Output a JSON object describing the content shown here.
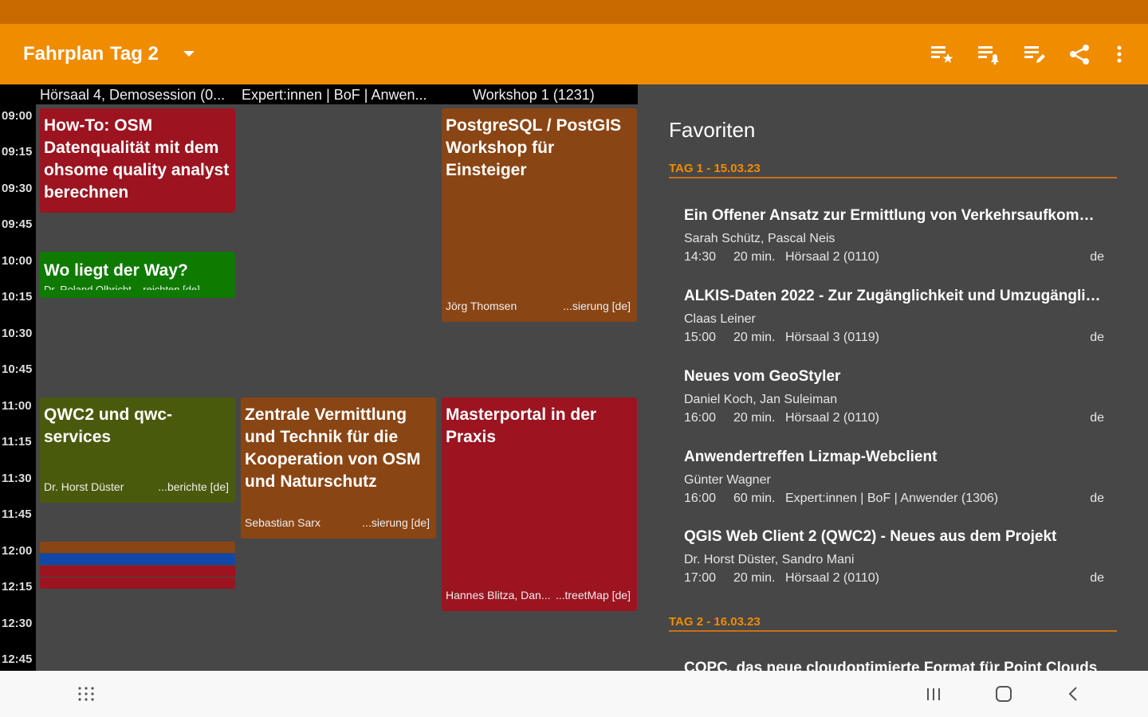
{
  "toolbar": {
    "app_title": "Fahrplan",
    "day_title": "Tag 2",
    "accent": "#f08c00",
    "icons": [
      "starred-list-icon",
      "alarm-list-icon",
      "changes-list-icon",
      "share-icon",
      "more-vert-icon"
    ]
  },
  "schedule": {
    "rooms": [
      "Hörsaal 4, Demosession (0...",
      "Expert:innen | BoF | Anwen...",
      "Workshop 1 (1231)"
    ],
    "times": [
      "09:00",
      "09:15",
      "09:30",
      "09:45",
      "10:00",
      "10:15",
      "10:30",
      "10:45",
      "11:00",
      "11:15",
      "11:30",
      "11:45",
      "12:00",
      "12:15",
      "12:30",
      "12:45"
    ],
    "events": [
      {
        "title": "How-To: OSM Datenqualität mit dem ohsome quality analyst berechnen",
        "speaker": "",
        "track": "",
        "color": "#9b1420"
      },
      {
        "title": "Wo liegt der Way?",
        "peek": "Dr. Roland Olbricht ...reichten [de]",
        "color": "#0e7a00"
      },
      {
        "title": "QWC2 und qwc-services",
        "speaker": "Dr. Horst Düster",
        "track": "...berichte [de]",
        "color": "#4a5a0c"
      },
      {
        "title": "Zentrale Vermittlung und Technik für die Kooperation von OSM und Naturschutz",
        "speaker": "Sebastian Sarx",
        "track": "...sierung [de]",
        "color": "#8a4514"
      },
      {
        "title": "PostgreSQL / PostGIS Workshop für Einsteiger",
        "speaker": "Jörg Thomsen",
        "track": "...sierung [de]",
        "color": "#8a4514"
      },
      {
        "title": "Masterportal in der Praxis",
        "speaker": "Hannes Blitza, Dan...",
        "track": "...treetMap [de]",
        "color": "#9b1420"
      }
    ],
    "bar_colors": [
      "#8a4514",
      "#1148a8",
      "#9b1420",
      "#9b1420"
    ]
  },
  "favorites": {
    "heading": "Favoriten",
    "days": [
      {
        "label": "TAG 1 - 15.03.23",
        "items": [
          {
            "title": "Ein Offener Ansatz zur Ermittlung von Verkehrsaufkommen...",
            "speakers": "Sarah Schütz, Pascal Neis",
            "time": "14:30",
            "duration": "20 min.",
            "room": "Hörsaal 2 (0110)",
            "lang": "de"
          },
          {
            "title": "ALKIS-Daten 2022 -  Zur Zugänglichkeit und Umzugänglich...",
            "speakers": "Claas Leiner",
            "time": "15:00",
            "duration": "20 min.",
            "room": "Hörsaal 3 (0119)",
            "lang": "de"
          },
          {
            "title": "Neues vom GeoStyler",
            "speakers": "Daniel Koch, Jan Suleiman",
            "time": "16:00",
            "duration": "20 min.",
            "room": "Hörsaal 2 (0110)",
            "lang": "de"
          },
          {
            "title": "Anwendertreffen Lizmap-Webclient",
            "speakers": "Günter Wagner",
            "time": "16:00",
            "duration": "60 min.",
            "room": "Expert:innen | BoF | Anwender (1306)",
            "lang": "de"
          },
          {
            "title": "QGIS Web Client 2 (QWC2) - Neues aus dem Projekt",
            "speakers": "Dr. Horst Düster, Sandro Mani",
            "time": "17:00",
            "duration": "20 min.",
            "room": "Hörsaal 2 (0110)",
            "lang": "de"
          }
        ]
      },
      {
        "label": "TAG 2 - 16.03.23",
        "items": [
          {
            "title": "COPC, das neue cloudoptimierte Format für Point Clouds"
          }
        ]
      }
    ]
  },
  "nav_bar": {
    "icons": [
      "apps-grid-icon",
      "recent-apps-icon",
      "home-icon",
      "back-icon"
    ]
  }
}
